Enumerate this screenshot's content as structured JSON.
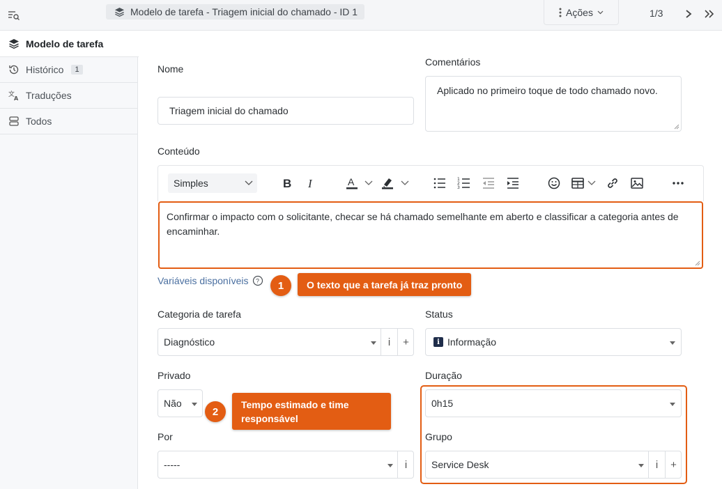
{
  "header": {
    "breadcrumb": "Modelo de tarefa -  Triagem inicial do chamado - ID 1",
    "actions_label": "Ações",
    "pager": "1/3"
  },
  "sidebar": {
    "items": [
      {
        "label": "Modelo de tarefa",
        "icon": "layers-icon"
      },
      {
        "label": "Histórico",
        "icon": "history-icon",
        "badge": "1"
      },
      {
        "label": "Traduções",
        "icon": "translate-icon"
      },
      {
        "label": "Todos",
        "icon": "list-icon"
      }
    ]
  },
  "form": {
    "name_label": "Nome",
    "name_value": "Triagem inicial do chamado",
    "comments_label": "Comentários",
    "comments_value": "Aplicado no primeiro toque de todo chamado novo.",
    "content_label": "Conteúdo",
    "editor": {
      "format_select": "Simples",
      "content": "Confirmar o impacto com o solicitante, checar se há chamado semelhante em aberto e classificar a categoria antes de encaminhar."
    },
    "vars_link": "Variáveis disponíveis",
    "category_label": "Categoria de tarefa",
    "category_value": "Diagnóstico",
    "status_label": "Status",
    "status_value": "Informação",
    "private_label": "Privado",
    "private_value": "Não",
    "duration_label": "Duração",
    "duration_value": "0h15",
    "by_label": "Por",
    "by_value": "-----",
    "group_label": "Grupo",
    "group_value": "Service Desk",
    "info_addon": "i",
    "add_addon": "+"
  },
  "callouts": [
    {
      "number": "1",
      "text": "O texto que a tarefa já traz pronto"
    },
    {
      "number": "2",
      "text": "Tempo estimado e time responsável"
    }
  ],
  "colors": {
    "accent": "#e35d13",
    "link": "#4a6fa0",
    "status_icon": "#1f2d4a"
  }
}
